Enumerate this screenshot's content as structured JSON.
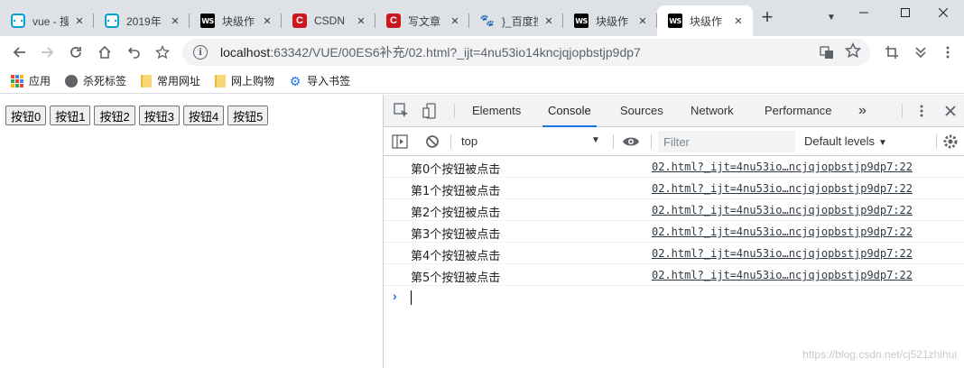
{
  "tabs": [
    {
      "title": "vue - 搜",
      "icon": "bilibili-icon",
      "active": false
    },
    {
      "title": "2019年",
      "icon": "bilibili-icon",
      "active": false
    },
    {
      "title": "块级作",
      "icon": "webstorm-icon",
      "active": false
    },
    {
      "title": "CSDN",
      "icon": "csdn-icon",
      "active": false
    },
    {
      "title": "写文章",
      "icon": "csdn-icon",
      "active": false
    },
    {
      "title": "}_百度搜",
      "icon": "baidu-icon",
      "active": false
    },
    {
      "title": "块级作",
      "icon": "webstorm-icon",
      "active": false
    },
    {
      "title": "块级作",
      "icon": "webstorm-icon",
      "active": true
    }
  ],
  "omnibox": {
    "host": "localhost",
    "rest": ":63342/VUE/00ES6补充/02.html?_ijt=4nu53io14kncjqjopbstjp9dp7"
  },
  "bookmarks": [
    {
      "label": "应用",
      "icon": "apps-icon"
    },
    {
      "label": "杀死标签",
      "icon": "globe-icon"
    },
    {
      "label": "常用网址",
      "icon": "folder-icon"
    },
    {
      "label": "网上购物",
      "icon": "folder-icon"
    },
    {
      "label": "导入书签",
      "icon": "gear-icon"
    }
  ],
  "page_buttons": [
    "按钮0",
    "按钮1",
    "按钮2",
    "按钮3",
    "按钮4",
    "按钮5"
  ],
  "devtools": {
    "tabs": [
      "Elements",
      "Console",
      "Sources",
      "Network",
      "Performance"
    ],
    "active_tab": "Console",
    "more": "»",
    "context": "top",
    "filter_placeholder": "Filter",
    "levels": "Default levels",
    "levels_arrow": "▼",
    "logs": [
      {
        "message": "第0个按钮被点击",
        "source": "02.html?_ijt=4nu53io…ncjqjopbstjp9dp7:22"
      },
      {
        "message": "第1个按钮被点击",
        "source": "02.html?_ijt=4nu53io…ncjqjopbstjp9dp7:22"
      },
      {
        "message": "第2个按钮被点击",
        "source": "02.html?_ijt=4nu53io…ncjqjopbstjp9dp7:22"
      },
      {
        "message": "第3个按钮被点击",
        "source": "02.html?_ijt=4nu53io…ncjqjopbstjp9dp7:22"
      },
      {
        "message": "第4个按钮被点击",
        "source": "02.html?_ijt=4nu53io…ncjqjopbstjp9dp7:22"
      },
      {
        "message": "第5个按钮被点击",
        "source": "02.html?_ijt=4nu53io…ncjqjopbstjp9dp7:22"
      }
    ],
    "prompt": "›"
  },
  "watermark": "https://blog.csdn.net/cj521zhihui",
  "colors": {
    "accent": "#1a73e8",
    "csdn": "#c9171e",
    "bilibili": "#00a1d6"
  }
}
